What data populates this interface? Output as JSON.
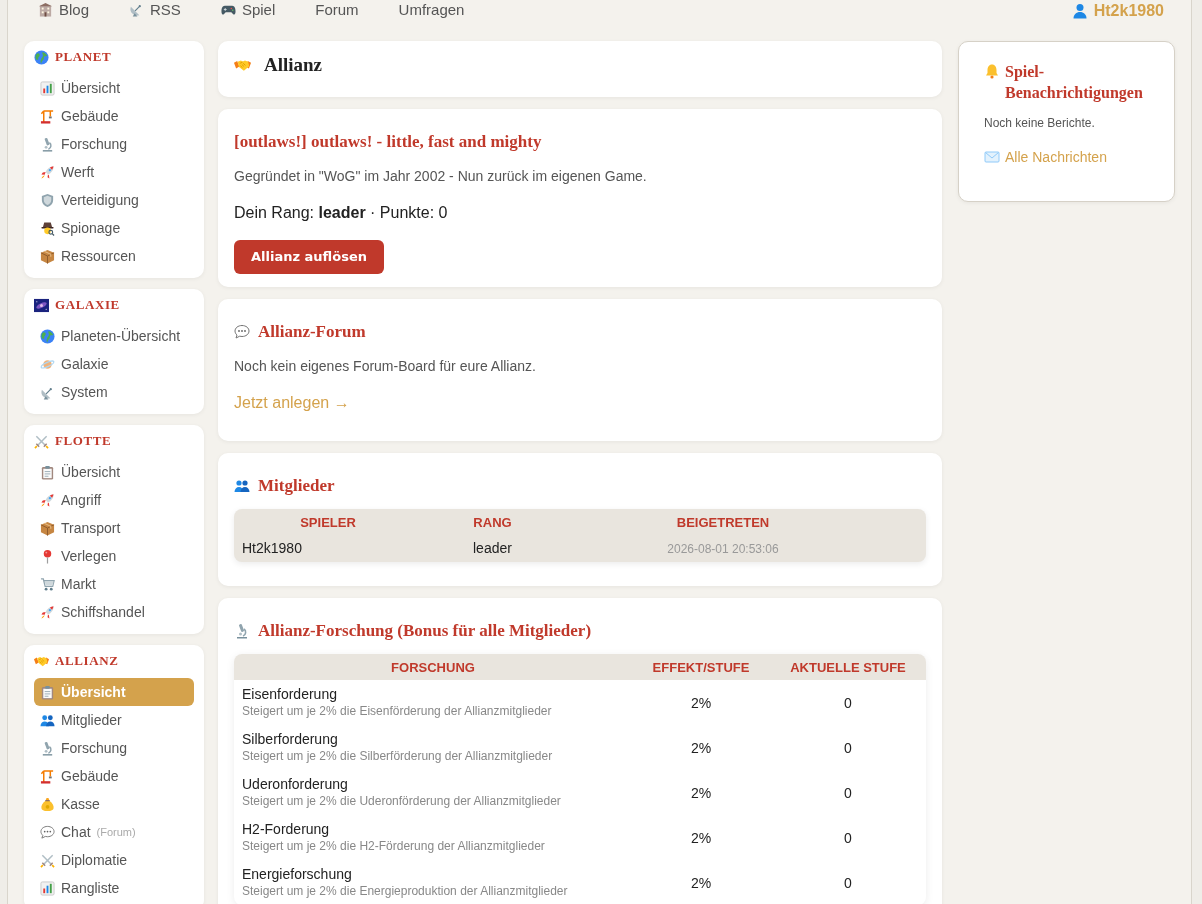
{
  "top_nav": {
    "links": [
      {
        "label": "Blog"
      },
      {
        "label": "RSS"
      },
      {
        "label": "Spiel"
      },
      {
        "label": "Forum"
      },
      {
        "label": "Umfragen"
      }
    ],
    "user": "Ht2k1980"
  },
  "sidebar": {
    "sections": [
      {
        "title": "PLANET",
        "items": [
          {
            "label": "Übersicht",
            "selected": false
          },
          {
            "label": "Gebäude",
            "selected": false
          },
          {
            "label": "Forschung",
            "selected": false
          },
          {
            "label": "Werft",
            "selected": false
          },
          {
            "label": "Verteidigung",
            "selected": false
          },
          {
            "label": "Spionage",
            "selected": false
          },
          {
            "label": "Ressourcen",
            "selected": false
          }
        ]
      },
      {
        "title": "GALAXIE",
        "items": [
          {
            "label": "Planeten-Übersicht",
            "selected": false
          },
          {
            "label": "Galaxie",
            "selected": false
          },
          {
            "label": "System",
            "selected": false
          }
        ]
      },
      {
        "title": "FLOTTE",
        "items": [
          {
            "label": "Übersicht",
            "selected": false
          },
          {
            "label": "Angriff",
            "selected": false
          },
          {
            "label": "Transport",
            "selected": false
          },
          {
            "label": "Verlegen",
            "selected": false
          },
          {
            "label": "Markt",
            "selected": false
          },
          {
            "label": "Schiffshandel",
            "selected": false
          }
        ]
      },
      {
        "title": "ALLIANZ",
        "items": [
          {
            "label": "Übersicht",
            "selected": true
          },
          {
            "label": "Mitglieder",
            "selected": false
          },
          {
            "label": "Forschung",
            "selected": false
          },
          {
            "label": "Gebäude",
            "selected": false
          },
          {
            "label": "Kasse",
            "selected": false
          },
          {
            "label": "Chat",
            "note": "(Forum)",
            "selected": false
          },
          {
            "label": "Diplomatie",
            "selected": false
          },
          {
            "label": "Rangliste",
            "selected": false
          }
        ]
      }
    ]
  },
  "page_title": "Allianz",
  "alliance": {
    "name": "[outlaws!] outlaws! - little, fast and mighty",
    "description": "Gegründet in \"WoG\" im Jahr 2002 - Nun zurück im eigenen Game.",
    "rank_line": "Dein Rang: **leader** · Punkte: 0",
    "dissolve_button": "Allianz auflösen"
  },
  "forum": {
    "title": "Allianz-Forum",
    "text": "Noch kein eigenes Forum-Board für eure Allianz.",
    "link": "Jetzt anlegen →"
  },
  "members": {
    "title": "Mitglieder",
    "columns": [
      "SPIELER",
      "RANG",
      "BEIGETRETEN"
    ],
    "rows": [
      [
        "Ht2k1980",
        "leader",
        "2026-08-01 20:53:06"
      ]
    ]
  },
  "research": {
    "title": "Allianz-Forschung (Bonus für alle Mitglieder)",
    "columns": [
      "FORSCHUNG",
      "EFFEKT/STUFE",
      "AKTUELLE STUFE"
    ],
    "rows": [
      {
        "name": "Eisenforderung",
        "description": "Steigert um je 2% die Eisenförderung der Allianzmitglieder",
        "effect": "2%",
        "current_stage": "0"
      },
      {
        "name": "Silberforderung",
        "description": "Steigert um je 2% die Silberförderung der Allianzmitglieder",
        "effect": "2%",
        "current_stage": "0"
      },
      {
        "name": "Uderonforderung",
        "description": "Steigert um je 2% die Uderonförderung der Allianzmitglieder",
        "effect": "2%",
        "current_stage": "0"
      },
      {
        "name": "H2-Forderung",
        "description": "Steigert um je 2% die H2-Förderung der Allianzmitglieder",
        "effect": "2%",
        "current_stage": "0"
      },
      {
        "name": "Energieforschung",
        "description": "Steigert um je 2% die Energieproduktion der Allianzmitglieder",
        "effect": "2%",
        "current_stage": "0"
      }
    ]
  },
  "notifications": {
    "title": "Spiel-Benachrichtigungen",
    "text": "Noch keine Berichte.",
    "link": "Alle Nachrichten"
  }
}
